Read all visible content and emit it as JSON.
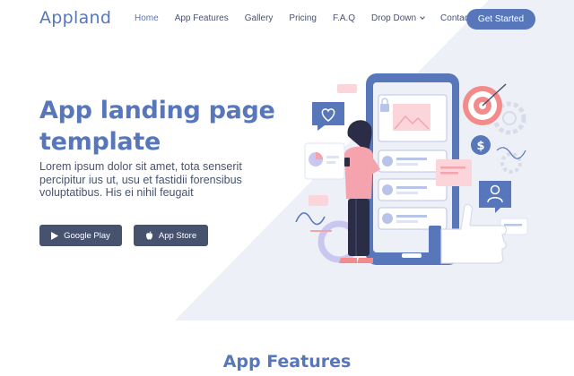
{
  "brand": {
    "logo": "Appland"
  },
  "nav": {
    "items": [
      {
        "label": "Home",
        "active": true
      },
      {
        "label": "App Features"
      },
      {
        "label": "Gallery"
      },
      {
        "label": "Pricing"
      },
      {
        "label": "F.A.Q"
      },
      {
        "label": "Drop Down",
        "has_dropdown": true
      },
      {
        "label": "Contact"
      }
    ],
    "cta": "Get Started"
  },
  "hero": {
    "title": "App landing page template",
    "subtitle": "Lorem ipsum dolor sit amet, tota senserit percipitur ius ut, usu et fastidii forensibus voluptatibus. His ei nihil feugait",
    "buttons": {
      "google_play": "Google Play",
      "app_store": "App Store"
    }
  },
  "next_section": {
    "title": "App Features"
  },
  "colors": {
    "primary": "#5777ba",
    "dark": "#47536e",
    "hero_bg": "#eef0f8",
    "accent_pink": "#f5a3ad"
  },
  "icons": [
    "play-icon",
    "apple-icon",
    "chevron-down-icon",
    "heart-icon",
    "dollar-icon",
    "user-icon",
    "image-icon",
    "lock-icon",
    "gear-icon",
    "target-icon",
    "thumbs-up-icon"
  ]
}
